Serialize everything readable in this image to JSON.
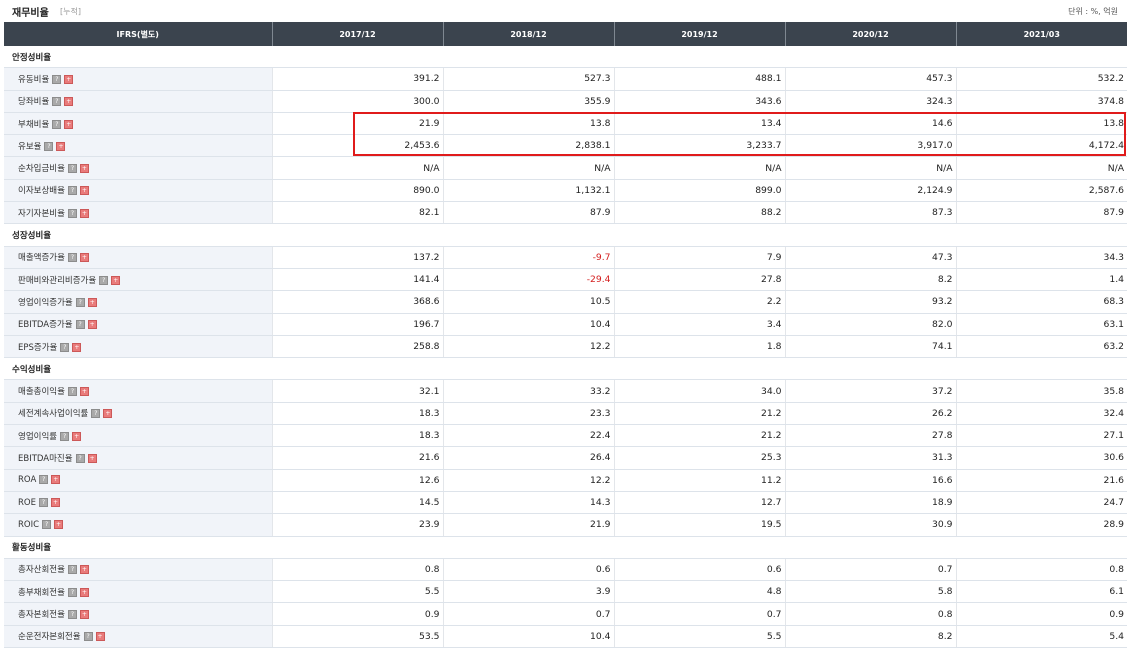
{
  "header": {
    "title": "재무비율",
    "subtitle": "[누적]",
    "unit": "단위 : %, 억원"
  },
  "columns": [
    "IFRS(별도)",
    "2017/12",
    "2018/12",
    "2019/12",
    "2020/12",
    "2021/03"
  ],
  "groups": [
    {
      "name": "안정성비율",
      "rows": [
        {
          "label": "유동비율",
          "values": [
            "391.2",
            "527.3",
            "488.1",
            "457.3",
            "532.2"
          ]
        },
        {
          "label": "당좌비율",
          "values": [
            "300.0",
            "355.9",
            "343.6",
            "324.3",
            "374.8"
          ]
        },
        {
          "label": "부채비율",
          "values": [
            "21.9",
            "13.8",
            "13.4",
            "14.6",
            "13.8"
          ]
        },
        {
          "label": "유보율",
          "values": [
            "2,453.6",
            "2,838.1",
            "3,233.7",
            "3,917.0",
            "4,172.4"
          ]
        },
        {
          "label": "순차입금비율",
          "values": [
            "N/A",
            "N/A",
            "N/A",
            "N/A",
            "N/A"
          ]
        },
        {
          "label": "이자보상배율",
          "values": [
            "890.0",
            "1,132.1",
            "899.0",
            "2,124.9",
            "2,587.6"
          ]
        },
        {
          "label": "자기자본비율",
          "values": [
            "82.1",
            "87.9",
            "88.2",
            "87.3",
            "87.9"
          ]
        }
      ]
    },
    {
      "name": "성장성비율",
      "rows": [
        {
          "label": "매출액증가율",
          "values": [
            "137.2",
            "-9.7",
            "7.9",
            "47.3",
            "34.3"
          ]
        },
        {
          "label": "판매비와관리비증가율",
          "values": [
            "141.4",
            "-29.4",
            "27.8",
            "8.2",
            "1.4"
          ]
        },
        {
          "label": "영업이익증가율",
          "values": [
            "368.6",
            "10.5",
            "2.2",
            "93.2",
            "68.3"
          ]
        },
        {
          "label": "EBITDA증가율",
          "values": [
            "196.7",
            "10.4",
            "3.4",
            "82.0",
            "63.1"
          ]
        },
        {
          "label": "EPS증가율",
          "values": [
            "258.8",
            "12.2",
            "1.8",
            "74.1",
            "63.2"
          ]
        }
      ]
    },
    {
      "name": "수익성비율",
      "rows": [
        {
          "label": "매출총이익율",
          "values": [
            "32.1",
            "33.2",
            "34.0",
            "37.2",
            "35.8"
          ]
        },
        {
          "label": "세전계속사업이익률",
          "values": [
            "18.3",
            "23.3",
            "21.2",
            "26.2",
            "32.4"
          ]
        },
        {
          "label": "영업이익률",
          "values": [
            "18.3",
            "22.4",
            "21.2",
            "27.8",
            "27.1"
          ]
        },
        {
          "label": "EBITDA마진율",
          "values": [
            "21.6",
            "26.4",
            "25.3",
            "31.3",
            "30.6"
          ]
        },
        {
          "label": "ROA",
          "values": [
            "12.6",
            "12.2",
            "11.2",
            "16.6",
            "21.6"
          ]
        },
        {
          "label": "ROE",
          "values": [
            "14.5",
            "14.3",
            "12.7",
            "18.9",
            "24.7"
          ]
        },
        {
          "label": "ROIC",
          "values": [
            "23.9",
            "21.9",
            "19.5",
            "30.9",
            "28.9"
          ]
        }
      ]
    },
    {
      "name": "활동성비율",
      "rows": [
        {
          "label": "총자산회전율",
          "values": [
            "0.8",
            "0.6",
            "0.6",
            "0.7",
            "0.8"
          ]
        },
        {
          "label": "총부채회전율",
          "values": [
            "5.5",
            "3.9",
            "4.8",
            "5.8",
            "6.1"
          ]
        },
        {
          "label": "총자본회전율",
          "values": [
            "0.9",
            "0.7",
            "0.7",
            "0.8",
            "0.9"
          ]
        },
        {
          "label": "순운전자본회전율",
          "values": [
            "53.5",
            "10.4",
            "5.5",
            "8.2",
            "5.4"
          ]
        }
      ]
    }
  ],
  "colors": {
    "header_bg": "#3b444e",
    "label_bg": "#f1f4f9",
    "negative": "#d42020",
    "highlight": "#e01b1b"
  }
}
